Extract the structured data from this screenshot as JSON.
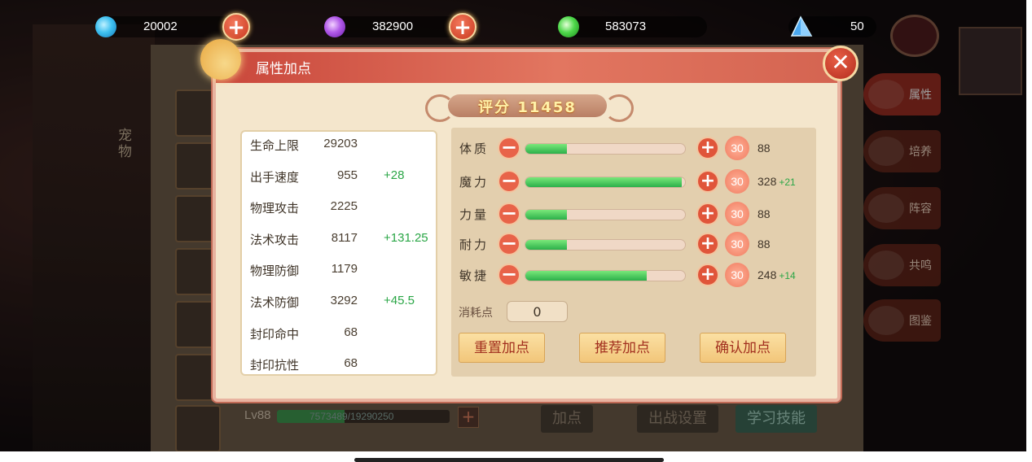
{
  "resources": [
    {
      "name": "blue-orb",
      "value": "20002",
      "color": "#3ec0f0"
    },
    {
      "name": "purple-orb",
      "value": "382900",
      "color": "#b058e8"
    },
    {
      "name": "green-orb",
      "value": "583073",
      "color": "#4ed84a"
    },
    {
      "name": "diamond",
      "value": "50",
      "color": "#4aa8f0"
    }
  ],
  "background": {
    "left_labels": [
      "宠",
      "物"
    ],
    "side_tabs": [
      "属性",
      "培养",
      "阵容",
      "共鸣",
      "图鉴"
    ],
    "level_text": "Lv88",
    "exp_text": "7573489/19290250",
    "bottom_buttons": [
      "加点",
      "出战设置",
      "学习技能"
    ]
  },
  "modal": {
    "title": "属性加点",
    "score_label": "评分",
    "score_value": "11458",
    "stats": [
      {
        "name": "生命上限",
        "value": "29203",
        "bonus": ""
      },
      {
        "name": "出手速度",
        "value": "955",
        "bonus": "+28"
      },
      {
        "name": "物理攻击",
        "value": "2225",
        "bonus": ""
      },
      {
        "name": "法术攻击",
        "value": "8117",
        "bonus": "+131.25"
      },
      {
        "name": "物理防御",
        "value": "1179",
        "bonus": ""
      },
      {
        "name": "法术防御",
        "value": "3292",
        "bonus": "+45.5"
      },
      {
        "name": "封印命中",
        "value": "68",
        "bonus": ""
      },
      {
        "name": "封印抗性",
        "value": "68",
        "bonus": ""
      }
    ],
    "attributes": [
      {
        "name": "体质",
        "step": "30",
        "value": "88",
        "bonus": "",
        "fill": 0.26
      },
      {
        "name": "魔力",
        "step": "30",
        "value": "328",
        "bonus": "+21",
        "fill": 0.98
      },
      {
        "name": "力量",
        "step": "30",
        "value": "88",
        "bonus": "",
        "fill": 0.26
      },
      {
        "name": "耐力",
        "step": "30",
        "value": "88",
        "bonus": "",
        "fill": 0.26
      },
      {
        "name": "敏捷",
        "step": "30",
        "value": "248",
        "bonus": "+14",
        "fill": 0.76
      }
    ],
    "cost_label": "消耗点",
    "cost_value": "0",
    "buttons": {
      "reset": "重置加点",
      "recommend": "推荐加点",
      "confirm": "确认加点"
    },
    "accent_color": "#c9473b"
  }
}
